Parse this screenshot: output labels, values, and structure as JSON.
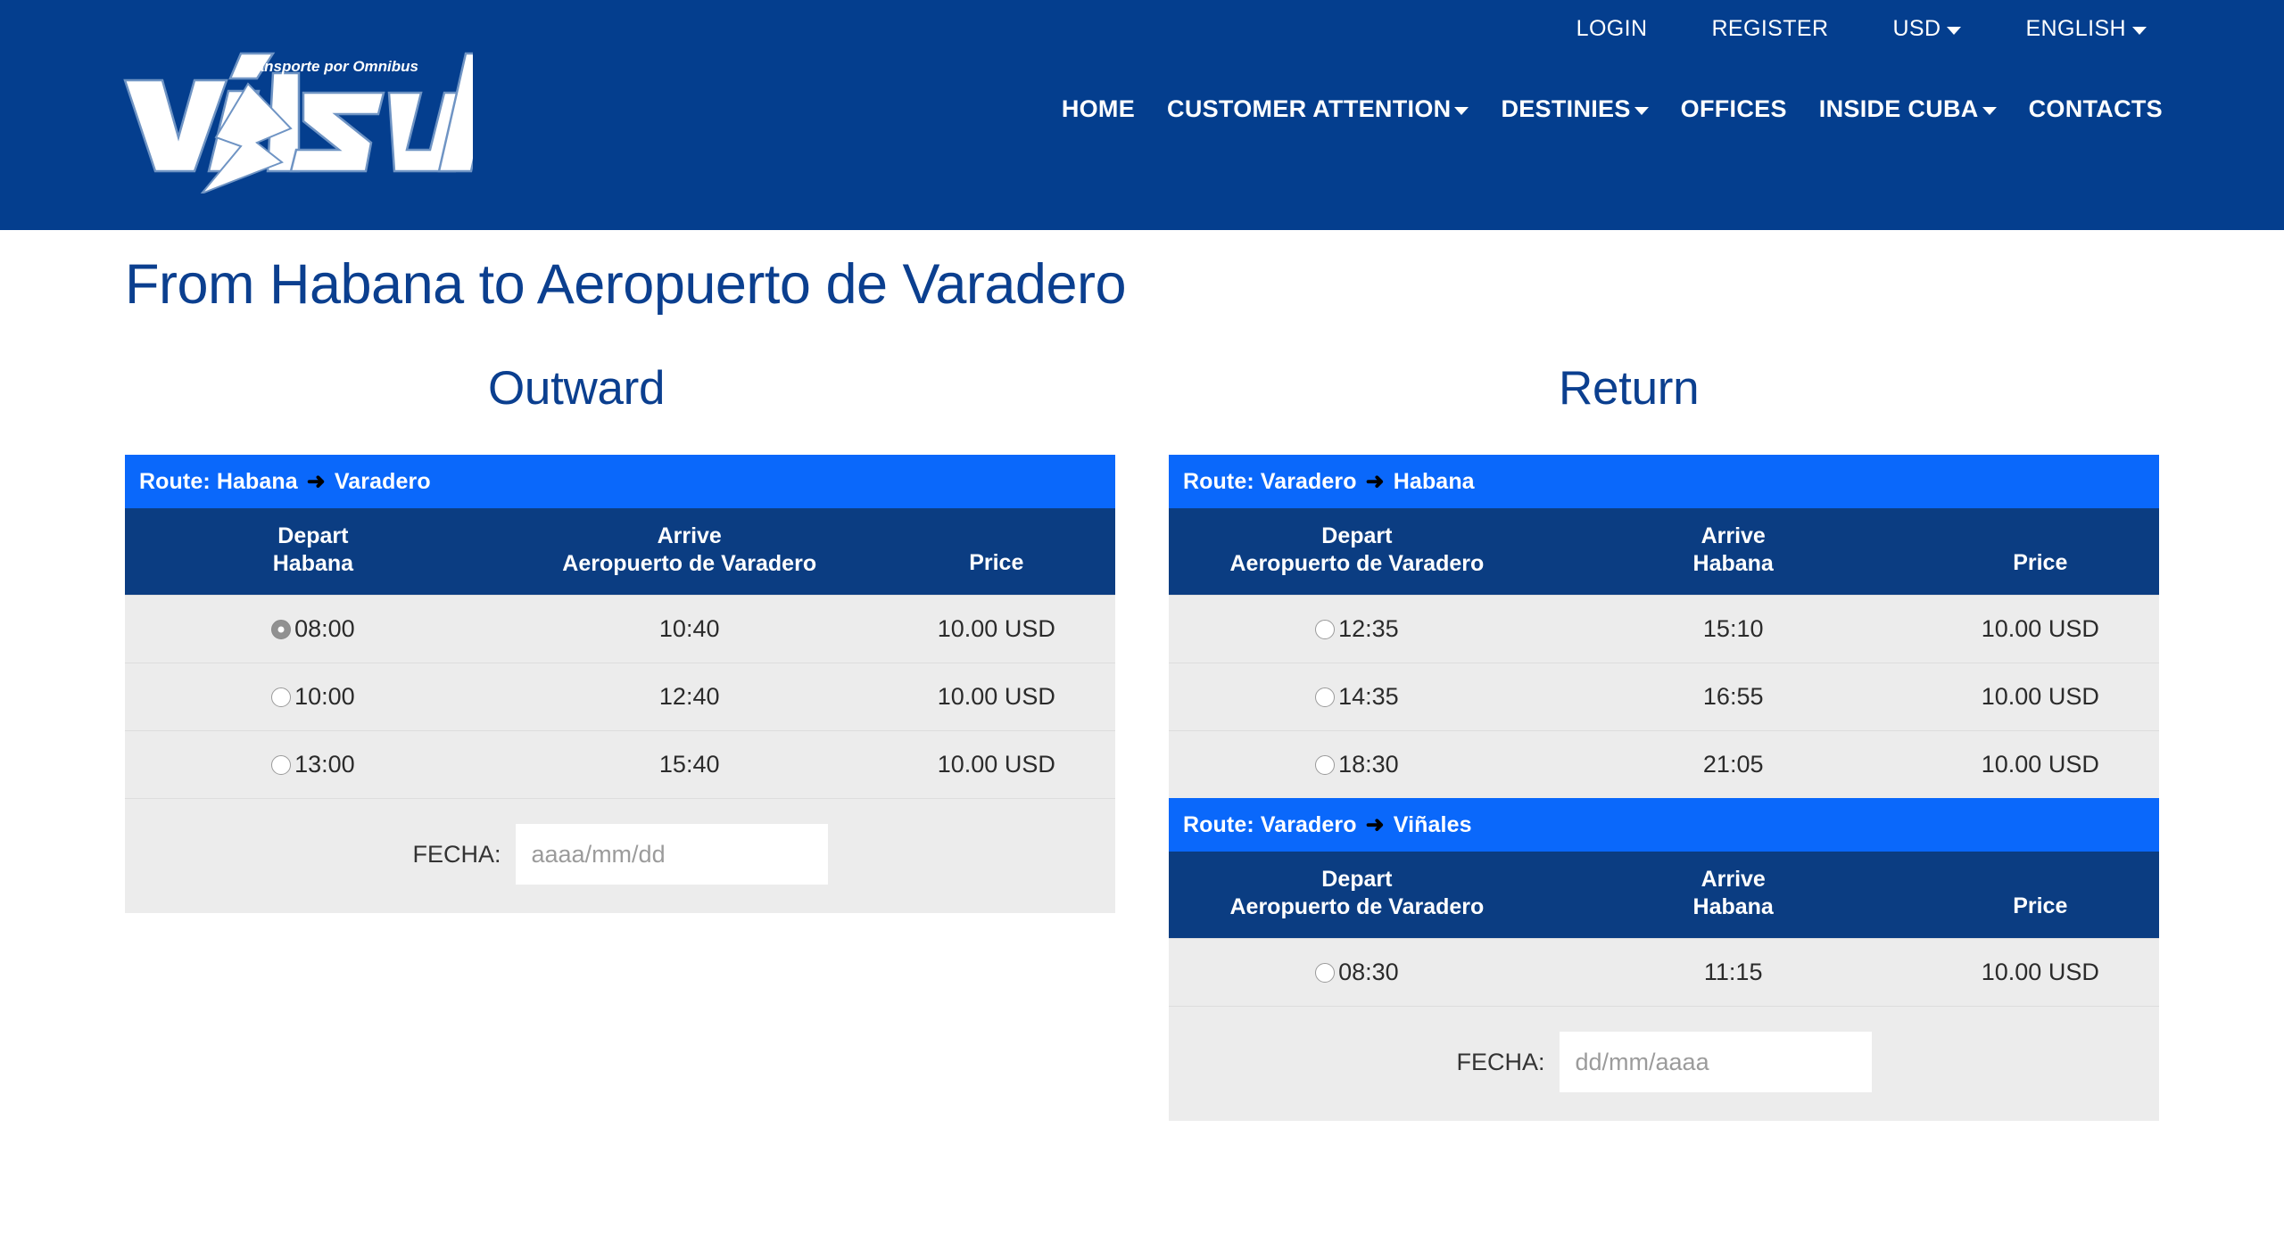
{
  "header": {
    "logo": {
      "wordmark": "viazul",
      "tagline": "Transporte por Omnibus"
    },
    "utility": [
      {
        "label": "LOGIN",
        "caret": false
      },
      {
        "label": "REGISTER",
        "caret": false
      },
      {
        "label": "USD",
        "caret": true
      },
      {
        "label": "ENGLISH",
        "caret": true
      }
    ],
    "nav": [
      {
        "label": "HOME",
        "caret": false
      },
      {
        "label": "CUSTOMER ATTENTION",
        "caret": true
      },
      {
        "label": "DESTINIES",
        "caret": true
      },
      {
        "label": "OFFICES",
        "caret": false
      },
      {
        "label": "INSIDE CUBA",
        "caret": true
      },
      {
        "label": "CONTACTS",
        "caret": false
      }
    ]
  },
  "page": {
    "title": "From Habana to Aeropuerto de Varadero",
    "outward_heading": "Outward",
    "return_heading": "Return"
  },
  "labels": {
    "route_prefix": "Route:",
    "arrow": "➜",
    "depart": "Depart",
    "arrive": "Arrive",
    "price": "Price",
    "fecha": "FECHA:"
  },
  "outward": {
    "route": {
      "from": "Habana",
      "to": "Varadero"
    },
    "columns": {
      "depart_city": "Habana",
      "arrive_city": "Aeropuerto de Varadero"
    },
    "rows": [
      {
        "depart": "08:00",
        "arrive": "10:40",
        "price": "10.00 USD",
        "selected": true
      },
      {
        "depart": "10:00",
        "arrive": "12:40",
        "price": "10.00 USD",
        "selected": false
      },
      {
        "depart": "13:00",
        "arrive": "15:40",
        "price": "10.00 USD",
        "selected": false
      }
    ],
    "date_placeholder": "aaaa/mm/dd",
    "date_value": ""
  },
  "return": {
    "tables": [
      {
        "route": {
          "from": "Varadero",
          "to": "Habana"
        },
        "columns": {
          "depart_city": "Aeropuerto de Varadero",
          "arrive_city": "Habana"
        },
        "rows": [
          {
            "depart": "12:35",
            "arrive": "15:10",
            "price": "10.00 USD",
            "selected": false
          },
          {
            "depart": "14:35",
            "arrive": "16:55",
            "price": "10.00 USD",
            "selected": false
          },
          {
            "depart": "18:30",
            "arrive": "21:05",
            "price": "10.00 USD",
            "selected": false
          }
        ]
      },
      {
        "route": {
          "from": "Varadero",
          "to": "Viñales"
        },
        "columns": {
          "depart_city": "Aeropuerto de Varadero",
          "arrive_city": "Habana"
        },
        "rows": [
          {
            "depart": "08:30",
            "arrive": "11:15",
            "price": "10.00 USD",
            "selected": false
          }
        ]
      }
    ],
    "date_placeholder": "dd/mm/aaaa",
    "date_value": ""
  },
  "colors": {
    "header_blue": "#043e8e",
    "route_bar_blue": "#0a68fb",
    "table_head_navy": "#0b3d82",
    "row_gray": "#ececec",
    "title_blue": "#0b3f8f"
  }
}
